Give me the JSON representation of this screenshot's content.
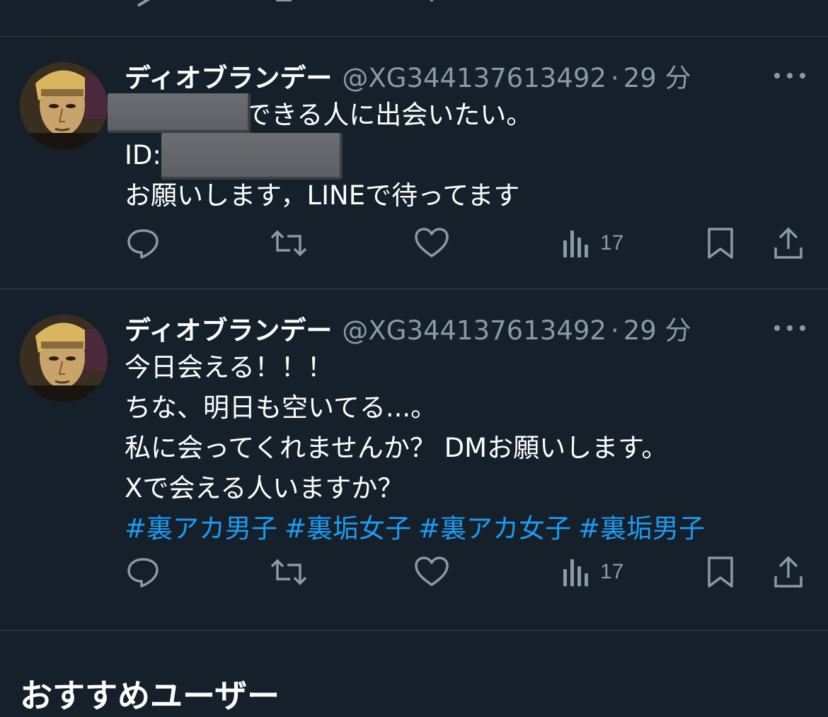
{
  "colors": {
    "background": "#15202b",
    "separator": "#38444d",
    "secondary_text": "#8b98a5",
    "hashtag": "#1d9bf0"
  },
  "icons": [
    "reply-icon",
    "retweet-icon",
    "like-icon",
    "views-icon",
    "bookmark-icon",
    "share-icon",
    "more-icon"
  ],
  "tweets": [
    {
      "display_name": "ディオブランデー",
      "handle": "@XG344137613492",
      "separator": "·",
      "time": "29 分",
      "lines": [
        "できる人に出会いたい。",
        "ID:",
        "お願いします，LINEで待ってます"
      ],
      "views": "17"
    },
    {
      "display_name": "ディオブランデー",
      "handle": "@XG344137613492",
      "separator": "·",
      "time": "29 分",
      "lines": [
        "今日会える！！！",
        "ちな、明日も空いてる...。",
        "私に会ってくれませんか？ DMお願いします。",
        "Xで会える人いますか？"
      ],
      "hashtags": [
        "#裏アカ男子",
        "#裏垢女子",
        "#裏アカ女子",
        "#裏垢男子"
      ],
      "views": "17"
    }
  ],
  "section_title": "おすすめユーザー"
}
